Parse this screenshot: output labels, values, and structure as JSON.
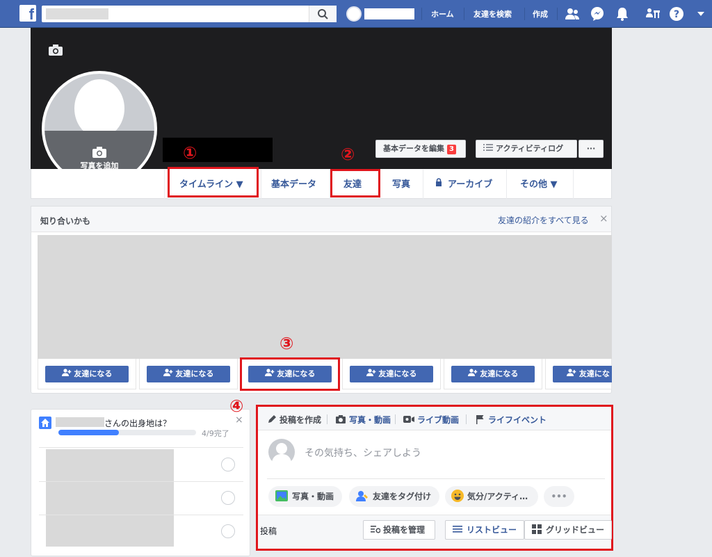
{
  "topbar": {
    "nav": [
      "ホーム",
      "友達を検索",
      "作成"
    ]
  },
  "cover": {
    "add_photo_label": "写真を追加",
    "edit_profile_label": "基本データを編集",
    "edit_profile_badge": "3",
    "activity_log_label": "アクティビティログ",
    "more_label": "···"
  },
  "tabs": {
    "timeline": "タイムライン ▼",
    "about": "基本データ",
    "friends": "友達",
    "photos": "写真",
    "archive": "アーカイブ",
    "more": "その他 ▼"
  },
  "annotations": [
    "①",
    "②",
    "③",
    "④"
  ],
  "pymk": {
    "title": "知り合いかも",
    "see_all": "友達の紹介をすべて見る",
    "close": "×",
    "add_friend_label": "友達になる",
    "add_friend_label_truncated": "友達にな"
  },
  "hometown": {
    "question": "さんの出身地は？",
    "progress_text": "4/9完了",
    "progress_fraction": 0.44,
    "close": "×"
  },
  "composer": {
    "tab_create_post": "投稿を作成",
    "tab_photo_video": "写真・動画",
    "tab_live_video": "ライブ動画",
    "tab_life_event": "ライフイベント",
    "placeholder": "その気持ち、シェアしよう",
    "pill_photo_video": "写真・動画",
    "pill_tag_friends": "友達をタグ付け",
    "pill_feeling": "気分/アクティ…",
    "pill_more": "•••",
    "posts_label": "投稿",
    "manage_posts": "投稿を管理",
    "list_view": "リストビュー",
    "grid_view": "グリッドビュー"
  },
  "colors": {
    "brand_blue": "#4267b2",
    "annotation_red": "#e0161d",
    "progress_blue": "#4080ff"
  }
}
